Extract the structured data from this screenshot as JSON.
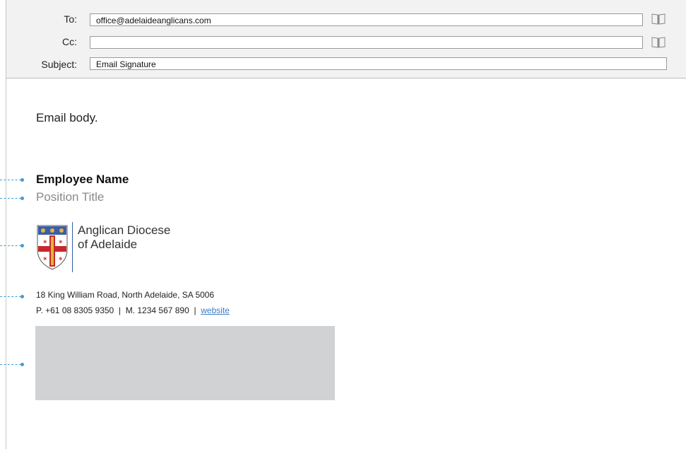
{
  "header": {
    "to_label": "To:",
    "to_value": "office@adelaideanglicans.com",
    "cc_label": "Cc:",
    "cc_value": "",
    "subject_label": "Subject:",
    "subject_value": "Email Signature",
    "address_book_icon": "address-book-icon"
  },
  "body": {
    "text": "Email body."
  },
  "signature": {
    "name": "Employee Name",
    "position": "Position Title",
    "org_line1": "Anglican Diocese",
    "org_line2": "of Adelaide",
    "address": "18 King William Road, North Adelaide, SA 5006",
    "phone": "P. +61 08 8305 9350",
    "sep1": "|",
    "mobile": "M. 1234 567 890",
    "sep2": "|",
    "website_label": "website",
    "crest_icon": "diocese-crest-icon",
    "banner_color": "#d1d2d4",
    "link_color": "#3b7dc4"
  },
  "annotations": {
    "guide_color": "#3aa0d8"
  }
}
